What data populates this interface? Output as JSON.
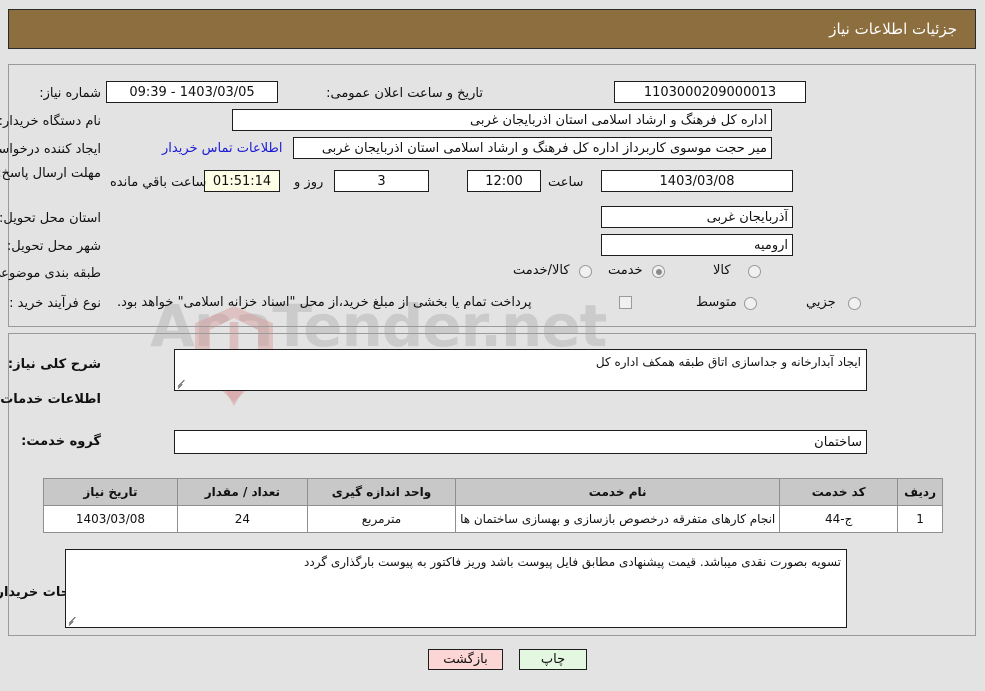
{
  "header": {
    "title": "جزئیات اطلاعات نیاز"
  },
  "watermark": {
    "text": "AnaTender.net"
  },
  "top_form": {
    "need_number_label": "شماره نیاز:",
    "need_number_value": "1103000209000013",
    "announce_label": "تاریخ و ساعت اعلان عمومی:",
    "announce_value": "1403/03/05 - 09:39",
    "buyer_org_label": "نام دستگاه خریدار:",
    "buyer_org_value": "اداره کل فرهنگ و ارشاد اسلامی استان اذربایجان غربی",
    "creator_label": "ایجاد کننده درخواست:",
    "creator_value": "میر حجت موسوی کاربرداز اداره کل فرهنگ و ارشاد اسلامی استان اذربایجان غربی",
    "contact_link": "اطلاعات تماس خریدار",
    "deadline_label": "مهلت ارسال پاسخ: تا تاریخ:",
    "deadline_date": "1403/03/08",
    "hour_label": "ساعت",
    "deadline_time": "12:00",
    "days_value": "3",
    "days_label": "روز و",
    "countdown_value": "01:51:14",
    "remaining_label": "ساعت باقي مانده",
    "province_label": "استان محل تحویل:",
    "province_value": "آذربایجان غربی",
    "city_label": "شهر محل تحویل:",
    "city_value": "ارومیه",
    "category_label": "طبقه بندی موضوعی:",
    "category_options": [
      {
        "label": "کالا",
        "selected": false
      },
      {
        "label": "خدمت",
        "selected": true
      },
      {
        "label": "کالا/خدمت",
        "selected": false
      }
    ],
    "process_label": "نوع فرآیند خرید :",
    "process_options": [
      {
        "label": "جزیي",
        "selected": false
      },
      {
        "label": "متوسط",
        "selected": false
      }
    ],
    "treasury_checkbox_checked": false,
    "treasury_note": "پرداخت تمام یا بخشی از مبلغ خرید،از محل \"اسناد خزانه اسلامی\" خواهد بود."
  },
  "middle": {
    "general_desc_label": "شرح کلی نیاز:",
    "general_desc_value": "ایجاد آبدارخانه و جداسازی اتاق طبقه همکف اداره کل",
    "section_title": "اطلاعات خدمات مورد نیاز",
    "service_group_label": "گروه خدمت:",
    "service_group_value": "ساختمان",
    "notes_label": "توضیحات خریدار:",
    "notes_value": "تسویه بصورت نقدی میباشد. قیمت پیشنهادی مطابق فایل پیوست باشد وریز فاکتور به پیوست بارگذاری گردد"
  },
  "table": {
    "columns": [
      "ردیف",
      "کد خدمت",
      "نام خدمت",
      "واحد اندازه گیری",
      "تعداد / مقدار",
      "تاریخ نیاز"
    ],
    "rows": [
      {
        "row_no": "1",
        "service_code": "ج-44",
        "service_name": "انجام کارهای متفرقه درخصوص بازسازی و بهسازی ساختمان ها",
        "unit": "مترمربع",
        "quantity": "24",
        "need_date": "1403/03/08"
      }
    ]
  },
  "footer": {
    "back_label": "بازگشت",
    "print_label": "چاپ"
  },
  "colors": {
    "header_bar": "#8d6e3f",
    "page_bg": "#e3e3e3",
    "link": "#1a1ad6",
    "table_header": "#c8c8c8",
    "back_button": "#fcd5d5",
    "print_button": "#e4f7e0",
    "countdown_field": "#fefee6"
  }
}
